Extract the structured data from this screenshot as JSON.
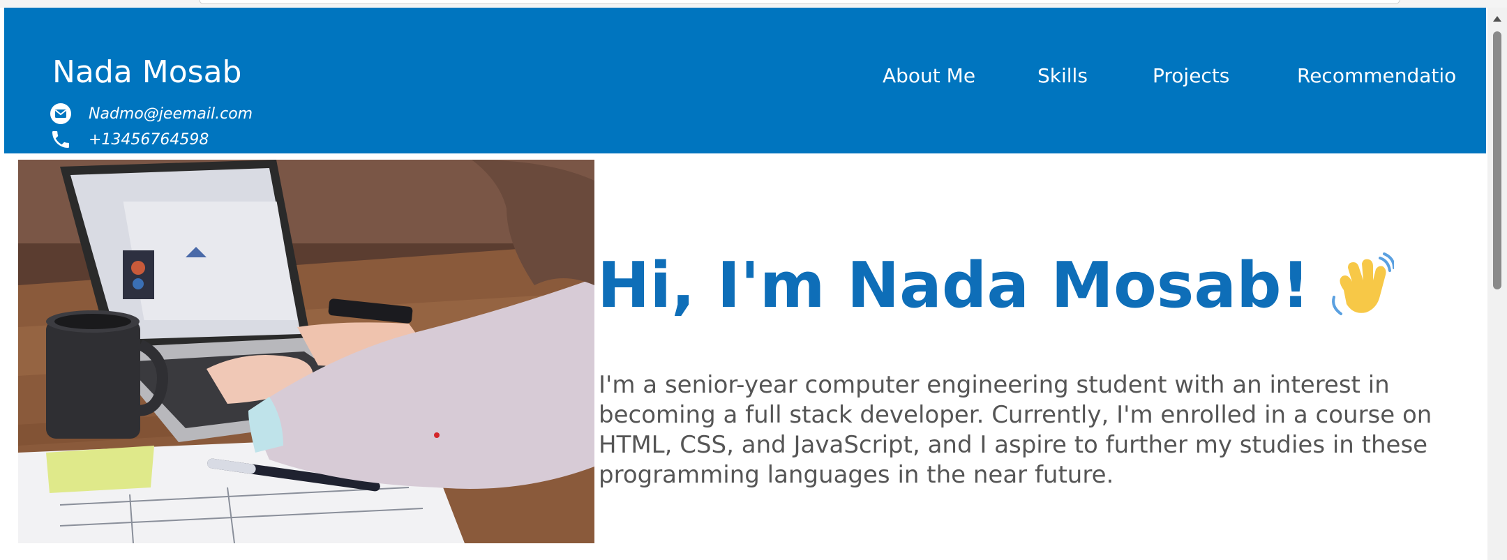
{
  "header": {
    "brand": "Nada Mosab",
    "email": "Nadmo@jeemail.com",
    "phone": "+13456764598",
    "email_icon": "email-icon",
    "phone_icon": "phone-icon",
    "bg_color": "#0075bf"
  },
  "nav": {
    "items": [
      "About Me",
      "Skills",
      "Projects",
      "Recommendatio"
    ]
  },
  "hero": {
    "image_alt": "Person typing on a laptop at a wooden desk",
    "title": "Hi, I'm Nada Mosab!",
    "emoji_icon": "waving-hand-icon",
    "description": "I'm a senior-year computer engineering student with an interest in becoming a full stack developer. Currently, I'm enrolled in a course on HTML, CSS, and JavaScript, and I aspire to further my studies in these programming languages in the near future.",
    "title_color": "#0e6eb8",
    "text_color": "#555555"
  }
}
